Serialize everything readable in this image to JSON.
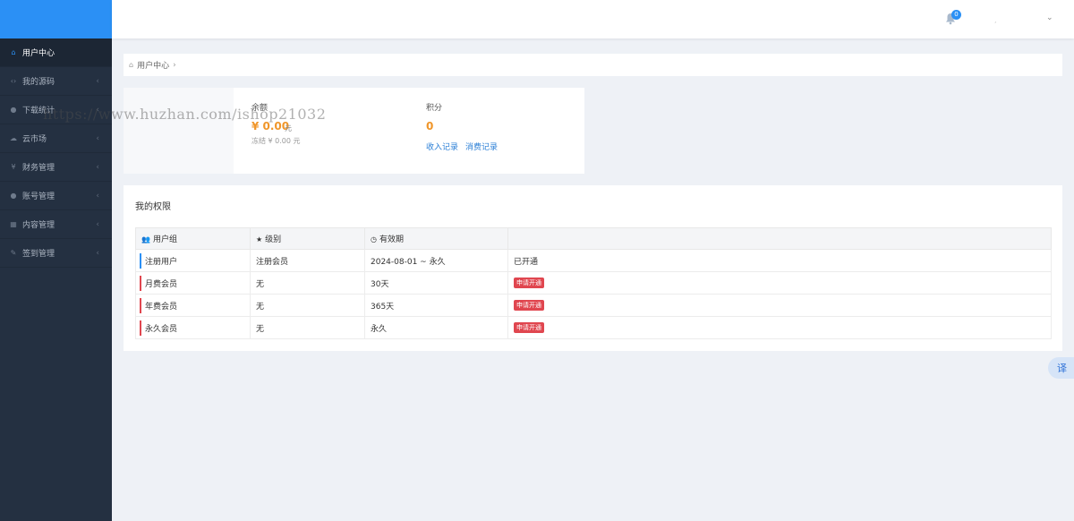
{
  "sidebar": {
    "items": [
      {
        "label": "用户中心",
        "icon": "home-icon"
      },
      {
        "label": "我的源码",
        "icon": "code-icon"
      },
      {
        "label": "下载统计",
        "icon": "user-icon"
      },
      {
        "label": "云市场",
        "icon": "cloud-icon"
      },
      {
        "label": "财务管理",
        "icon": "yen-icon"
      },
      {
        "label": "账号管理",
        "icon": "user-icon"
      },
      {
        "label": "内容管理",
        "icon": "grid-icon"
      },
      {
        "label": "签到管理",
        "icon": "edit-icon"
      }
    ]
  },
  "header": {
    "notification_count": "0"
  },
  "breadcrumb": {
    "current": "用户中心"
  },
  "balance": {
    "label": "余额",
    "amount": "¥ 0.00",
    "unit": "元",
    "frozen": "冻结 ¥ 0.00 元",
    "points_label": "积分",
    "points_value": "0",
    "income_link": "收入记录",
    "spend_link": "消费记录"
  },
  "permissions": {
    "title": "我的权限",
    "columns": [
      "用户组",
      "级别",
      "有效期",
      ""
    ],
    "rows": [
      {
        "group": "注册用户",
        "level": "注册会员",
        "validity": "2024-08-01 ~ 永久",
        "status": "已开通",
        "bar_color": "#2b90f5"
      },
      {
        "group": "月费会员",
        "level": "无",
        "validity": "30天",
        "status": "申请开通",
        "bar_color": "#e0464f"
      },
      {
        "group": "年费会员",
        "level": "无",
        "validity": "365天",
        "status": "申请开通",
        "bar_color": "#e0464f"
      },
      {
        "group": "永久会员",
        "level": "无",
        "validity": "永久",
        "status": "申请开通",
        "bar_color": "#e0464f"
      }
    ]
  },
  "watermark": "https://www.huzhan.com/ishop21032",
  "translate_label": "译",
  "colors": {
    "accent": "#2b90f5",
    "sidebar_bg": "#243041",
    "amount": "#f0962a",
    "danger": "#e0464f"
  }
}
